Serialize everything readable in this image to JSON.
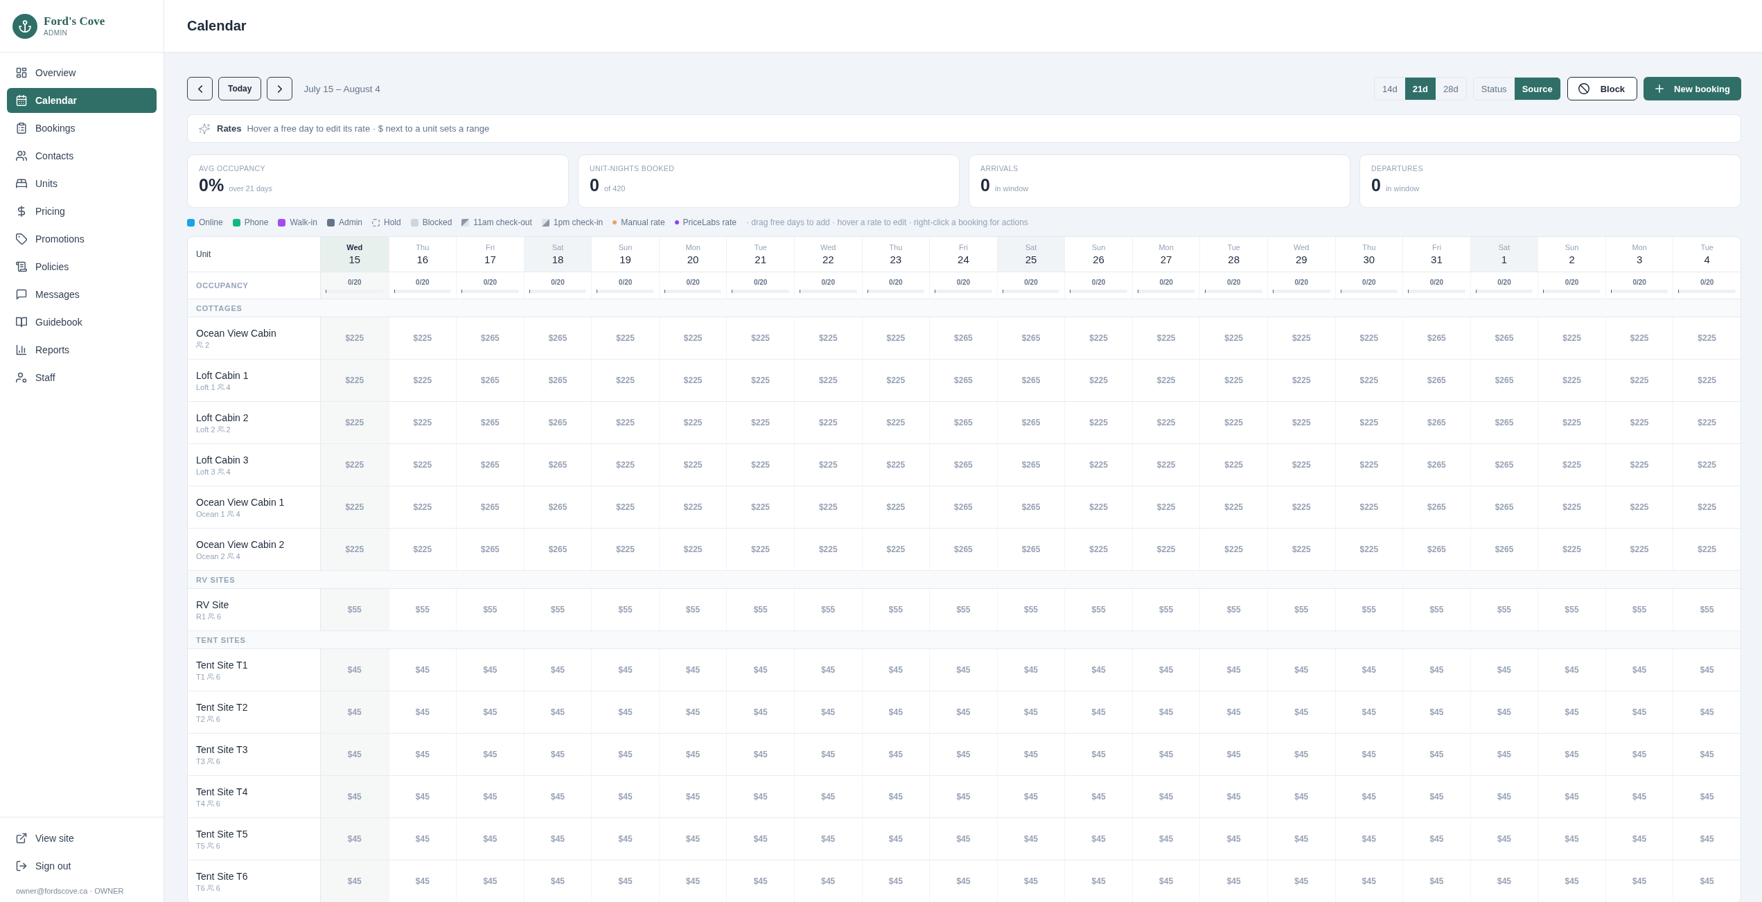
{
  "sidebar": {
    "brand": {
      "name": "Ford's Cove",
      "subtitle": "ADMIN"
    },
    "nav": [
      {
        "label": "Overview",
        "selected": false
      },
      {
        "label": "Calendar",
        "selected": true
      },
      {
        "label": "Bookings",
        "selected": false
      },
      {
        "label": "Contacts",
        "selected": false
      },
      {
        "label": "Units",
        "selected": false
      },
      {
        "label": "Pricing",
        "selected": false
      },
      {
        "label": "Promotions",
        "selected": false
      },
      {
        "label": "Policies",
        "selected": false
      },
      {
        "label": "Messages",
        "selected": false
      },
      {
        "label": "Guidebook",
        "selected": false
      },
      {
        "label": "Reports",
        "selected": false
      },
      {
        "label": "Staff",
        "selected": false
      }
    ],
    "footer_links": [
      {
        "label": "View site"
      },
      {
        "label": "Sign out"
      }
    ],
    "user": "owner@fordscove.ca · OWNER"
  },
  "header": {
    "title": "Calendar"
  },
  "toolbar": {
    "today_button": "Today",
    "range": "July 15 – August 4",
    "span_options": [
      {
        "label": "14d",
        "selected": false
      },
      {
        "label": "21d",
        "selected": true
      },
      {
        "label": "28d",
        "selected": false
      }
    ],
    "color_modes": [
      {
        "label": "Status",
        "selected": false
      },
      {
        "label": "Source",
        "selected": true
      }
    ],
    "block_button": "Block",
    "new_booking_button": "New booking"
  },
  "rates_bar": {
    "title": "Rates",
    "text": "Hover a free day to edit its rate · $ next to a unit sets a range"
  },
  "stats": [
    {
      "label": "AVG OCCUPANCY",
      "value": "0%",
      "note": "over 21 days"
    },
    {
      "label": "UNIT-NIGHTS BOOKED",
      "value": "0",
      "note": "of 420"
    },
    {
      "label": "ARRIVALS",
      "value": "0",
      "note": "in window"
    },
    {
      "label": "DEPARTURES",
      "value": "0",
      "note": "in window"
    }
  ],
  "legend": {
    "items": [
      {
        "kind": "swatch",
        "label": "Online",
        "color": "#1aa3e8"
      },
      {
        "kind": "swatch",
        "label": "Phone",
        "color": "#10b981"
      },
      {
        "kind": "swatch",
        "label": "Walk-in",
        "color": "#a04cf5"
      },
      {
        "kind": "swatch",
        "label": "Admin",
        "color": "#64748b"
      },
      {
        "kind": "hold",
        "label": "Hold"
      },
      {
        "kind": "swatch",
        "label": "Blocked",
        "color": "#cdd5df"
      },
      {
        "kind": "checkout",
        "label": "11am check-out"
      },
      {
        "kind": "checkin",
        "label": "1pm check-in"
      },
      {
        "kind": "dot",
        "label": "Manual rate",
        "color": "#e6a36b"
      },
      {
        "kind": "dot",
        "label": "PriceLabs rate",
        "color": "#9340ee"
      }
    ],
    "hint": "· drag free days to add · hover a rate to edit · right-click a booking for actions"
  },
  "calendar": {
    "unit_header": "Unit",
    "occupancy_label": "OCCUPANCY",
    "days": [
      {
        "weekday": "Wed",
        "date": "15",
        "today": true,
        "shaded": false,
        "occupancy": "0/20",
        "level": 0
      },
      {
        "weekday": "Thu",
        "date": "16",
        "today": false,
        "shaded": false,
        "occupancy": "0/20",
        "level": 0
      },
      {
        "weekday": "Fri",
        "date": "17",
        "today": false,
        "shaded": false,
        "occupancy": "0/20",
        "level": 0
      },
      {
        "weekday": "Sat",
        "date": "18",
        "today": false,
        "shaded": true,
        "occupancy": "0/20",
        "level": 0
      },
      {
        "weekday": "Sun",
        "date": "19",
        "today": false,
        "shaded": false,
        "occupancy": "0/20",
        "level": 0
      },
      {
        "weekday": "Mon",
        "date": "20",
        "today": false,
        "shaded": false,
        "occupancy": "0/20",
        "level": 0
      },
      {
        "weekday": "Tue",
        "date": "21",
        "today": false,
        "shaded": false,
        "occupancy": "0/20",
        "level": 0
      },
      {
        "weekday": "Wed",
        "date": "22",
        "today": false,
        "shaded": false,
        "occupancy": "0/20",
        "level": 0
      },
      {
        "weekday": "Thu",
        "date": "23",
        "today": false,
        "shaded": false,
        "occupancy": "0/20",
        "level": 0
      },
      {
        "weekday": "Fri",
        "date": "24",
        "today": false,
        "shaded": false,
        "occupancy": "0/20",
        "level": 0
      },
      {
        "weekday": "Sat",
        "date": "25",
        "today": false,
        "shaded": true,
        "occupancy": "0/20",
        "level": 0
      },
      {
        "weekday": "Sun",
        "date": "26",
        "today": false,
        "shaded": false,
        "occupancy": "0/20",
        "level": 0
      },
      {
        "weekday": "Mon",
        "date": "27",
        "today": false,
        "shaded": false,
        "occupancy": "0/20",
        "level": 0
      },
      {
        "weekday": "Tue",
        "date": "28",
        "today": false,
        "shaded": false,
        "occupancy": "0/20",
        "level": 0
      },
      {
        "weekday": "Wed",
        "date": "29",
        "today": false,
        "shaded": false,
        "occupancy": "0/20",
        "level": 0
      },
      {
        "weekday": "Thu",
        "date": "30",
        "today": false,
        "shaded": false,
        "occupancy": "0/20",
        "level": 0
      },
      {
        "weekday": "Fri",
        "date": "31",
        "today": false,
        "shaded": false,
        "occupancy": "0/20",
        "level": 0
      },
      {
        "weekday": "Sat",
        "date": "1",
        "today": false,
        "shaded": true,
        "occupancy": "0/20",
        "level": 0
      },
      {
        "weekday": "Sun",
        "date": "2",
        "today": false,
        "shaded": false,
        "occupancy": "0/20",
        "level": 0
      },
      {
        "weekday": "Mon",
        "date": "3",
        "today": false,
        "shaded": false,
        "occupancy": "0/20",
        "level": 0
      },
      {
        "weekday": "Tue",
        "date": "4",
        "today": false,
        "shaded": false,
        "occupancy": "0/20",
        "level": 0
      }
    ],
    "groups": [
      {
        "name": "COTTAGES",
        "units": [
          {
            "name": "Ocean View Cabin",
            "capacity": "2",
            "rates": [
              "$225",
              "$225",
              "$265",
              "$265",
              "$225",
              "$225",
              "$225",
              "$225",
              "$225",
              "$265",
              "$265",
              "$225",
              "$225",
              "$225",
              "$225",
              "$225",
              "$265",
              "$265",
              "$225",
              "$225",
              "$225"
            ]
          },
          {
            "name": "Loft Cabin 1",
            "code": "Loft 1",
            "capacity": "4",
            "rates": [
              "$225",
              "$225",
              "$265",
              "$265",
              "$225",
              "$225",
              "$225",
              "$225",
              "$225",
              "$265",
              "$265",
              "$225",
              "$225",
              "$225",
              "$225",
              "$225",
              "$265",
              "$265",
              "$225",
              "$225",
              "$225"
            ]
          },
          {
            "name": "Loft Cabin 2",
            "code": "Loft 2",
            "capacity": "2",
            "rates": [
              "$225",
              "$225",
              "$265",
              "$265",
              "$225",
              "$225",
              "$225",
              "$225",
              "$225",
              "$265",
              "$265",
              "$225",
              "$225",
              "$225",
              "$225",
              "$225",
              "$265",
              "$265",
              "$225",
              "$225",
              "$225"
            ]
          },
          {
            "name": "Loft Cabin 3",
            "code": "Loft 3",
            "capacity": "4",
            "rates": [
              "$225",
              "$225",
              "$265",
              "$265",
              "$225",
              "$225",
              "$225",
              "$225",
              "$225",
              "$265",
              "$265",
              "$225",
              "$225",
              "$225",
              "$225",
              "$225",
              "$265",
              "$265",
              "$225",
              "$225",
              "$225"
            ]
          },
          {
            "name": "Ocean View Cabin 1",
            "code": "Ocean 1",
            "capacity": "4",
            "rates": [
              "$225",
              "$225",
              "$265",
              "$265",
              "$225",
              "$225",
              "$225",
              "$225",
              "$225",
              "$265",
              "$265",
              "$225",
              "$225",
              "$225",
              "$225",
              "$225",
              "$265",
              "$265",
              "$225",
              "$225",
              "$225"
            ]
          },
          {
            "name": "Ocean View Cabin 2",
            "code": "Ocean 2",
            "capacity": "4",
            "rates": [
              "$225",
              "$225",
              "$265",
              "$265",
              "$225",
              "$225",
              "$225",
              "$225",
              "$225",
              "$265",
              "$265",
              "$225",
              "$225",
              "$225",
              "$225",
              "$225",
              "$265",
              "$265",
              "$225",
              "$225",
              "$225"
            ]
          }
        ]
      },
      {
        "name": "RV SITES",
        "units": [
          {
            "name": "RV Site",
            "code": "R1",
            "capacity": "6",
            "rates": [
              "$55",
              "$55",
              "$55",
              "$55",
              "$55",
              "$55",
              "$55",
              "$55",
              "$55",
              "$55",
              "$55",
              "$55",
              "$55",
              "$55",
              "$55",
              "$55",
              "$55",
              "$55",
              "$55",
              "$55",
              "$55"
            ]
          }
        ]
      },
      {
        "name": "TENT SITES",
        "units": [
          {
            "name": "Tent Site T1",
            "code": "T1",
            "capacity": "6",
            "rates": [
              "$45",
              "$45",
              "$45",
              "$45",
              "$45",
              "$45",
              "$45",
              "$45",
              "$45",
              "$45",
              "$45",
              "$45",
              "$45",
              "$45",
              "$45",
              "$45",
              "$45",
              "$45",
              "$45",
              "$45",
              "$45"
            ]
          },
          {
            "name": "Tent Site T2",
            "code": "T2",
            "capacity": "6",
            "rates": [
              "$45",
              "$45",
              "$45",
              "$45",
              "$45",
              "$45",
              "$45",
              "$45",
              "$45",
              "$45",
              "$45",
              "$45",
              "$45",
              "$45",
              "$45",
              "$45",
              "$45",
              "$45",
              "$45",
              "$45",
              "$45"
            ]
          },
          {
            "name": "Tent Site T3",
            "code": "T3",
            "capacity": "6",
            "rates": [
              "$45",
              "$45",
              "$45",
              "$45",
              "$45",
              "$45",
              "$45",
              "$45",
              "$45",
              "$45",
              "$45",
              "$45",
              "$45",
              "$45",
              "$45",
              "$45",
              "$45",
              "$45",
              "$45",
              "$45",
              "$45"
            ]
          },
          {
            "name": "Tent Site T4",
            "code": "T4",
            "capacity": "6",
            "rates": [
              "$45",
              "$45",
              "$45",
              "$45",
              "$45",
              "$45",
              "$45",
              "$45",
              "$45",
              "$45",
              "$45",
              "$45",
              "$45",
              "$45",
              "$45",
              "$45",
              "$45",
              "$45",
              "$45",
              "$45",
              "$45"
            ]
          },
          {
            "name": "Tent Site T5",
            "code": "T5",
            "capacity": "6",
            "rates": [
              "$45",
              "$45",
              "$45",
              "$45",
              "$45",
              "$45",
              "$45",
              "$45",
              "$45",
              "$45",
              "$45",
              "$45",
              "$45",
              "$45",
              "$45",
              "$45",
              "$45",
              "$45",
              "$45",
              "$45",
              "$45"
            ]
          },
          {
            "name": "Tent Site T6",
            "code": "T6",
            "capacity": "6",
            "rates": [
              "$45",
              "$45",
              "$45",
              "$45",
              "$45",
              "$45",
              "$45",
              "$45",
              "$45",
              "$45",
              "$45",
              "$45",
              "$45",
              "$45",
              "$45",
              "$45",
              "$45",
              "$45",
              "$45",
              "$45",
              "$45"
            ]
          }
        ]
      }
    ]
  }
}
